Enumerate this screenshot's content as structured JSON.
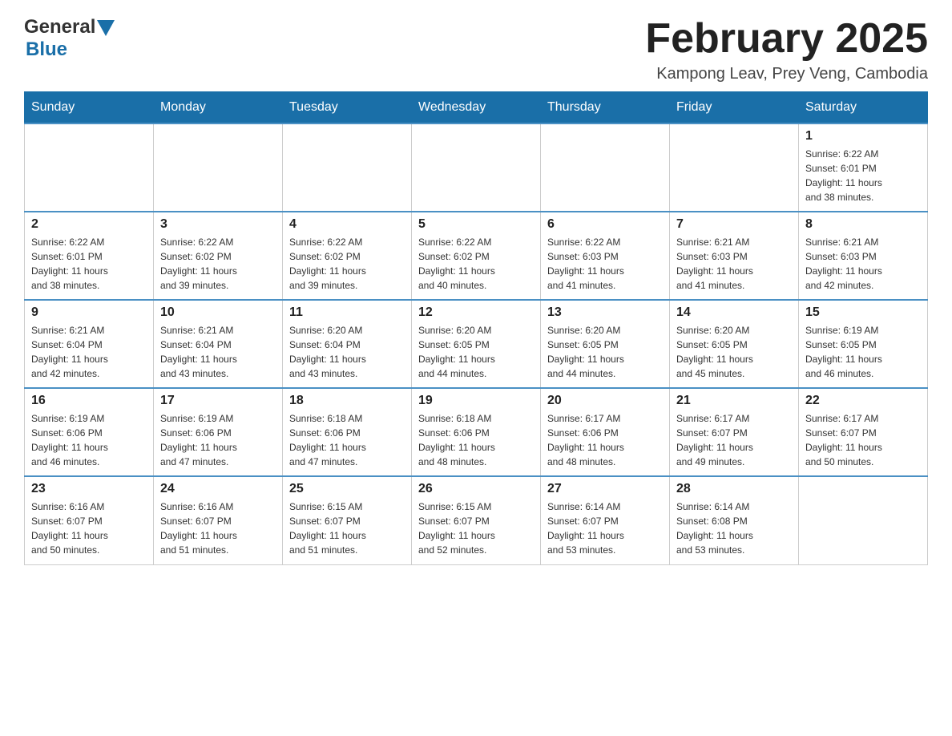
{
  "header": {
    "logo_general": "General",
    "logo_blue": "Blue",
    "month_title": "February 2025",
    "location": "Kampong Leav, Prey Veng, Cambodia"
  },
  "days_of_week": [
    "Sunday",
    "Monday",
    "Tuesday",
    "Wednesday",
    "Thursday",
    "Friday",
    "Saturday"
  ],
  "weeks": [
    [
      {
        "day": "",
        "info": ""
      },
      {
        "day": "",
        "info": ""
      },
      {
        "day": "",
        "info": ""
      },
      {
        "day": "",
        "info": ""
      },
      {
        "day": "",
        "info": ""
      },
      {
        "day": "",
        "info": ""
      },
      {
        "day": "1",
        "info": "Sunrise: 6:22 AM\nSunset: 6:01 PM\nDaylight: 11 hours\nand 38 minutes."
      }
    ],
    [
      {
        "day": "2",
        "info": "Sunrise: 6:22 AM\nSunset: 6:01 PM\nDaylight: 11 hours\nand 38 minutes."
      },
      {
        "day": "3",
        "info": "Sunrise: 6:22 AM\nSunset: 6:02 PM\nDaylight: 11 hours\nand 39 minutes."
      },
      {
        "day": "4",
        "info": "Sunrise: 6:22 AM\nSunset: 6:02 PM\nDaylight: 11 hours\nand 39 minutes."
      },
      {
        "day": "5",
        "info": "Sunrise: 6:22 AM\nSunset: 6:02 PM\nDaylight: 11 hours\nand 40 minutes."
      },
      {
        "day": "6",
        "info": "Sunrise: 6:22 AM\nSunset: 6:03 PM\nDaylight: 11 hours\nand 41 minutes."
      },
      {
        "day": "7",
        "info": "Sunrise: 6:21 AM\nSunset: 6:03 PM\nDaylight: 11 hours\nand 41 minutes."
      },
      {
        "day": "8",
        "info": "Sunrise: 6:21 AM\nSunset: 6:03 PM\nDaylight: 11 hours\nand 42 minutes."
      }
    ],
    [
      {
        "day": "9",
        "info": "Sunrise: 6:21 AM\nSunset: 6:04 PM\nDaylight: 11 hours\nand 42 minutes."
      },
      {
        "day": "10",
        "info": "Sunrise: 6:21 AM\nSunset: 6:04 PM\nDaylight: 11 hours\nand 43 minutes."
      },
      {
        "day": "11",
        "info": "Sunrise: 6:20 AM\nSunset: 6:04 PM\nDaylight: 11 hours\nand 43 minutes."
      },
      {
        "day": "12",
        "info": "Sunrise: 6:20 AM\nSunset: 6:05 PM\nDaylight: 11 hours\nand 44 minutes."
      },
      {
        "day": "13",
        "info": "Sunrise: 6:20 AM\nSunset: 6:05 PM\nDaylight: 11 hours\nand 44 minutes."
      },
      {
        "day": "14",
        "info": "Sunrise: 6:20 AM\nSunset: 6:05 PM\nDaylight: 11 hours\nand 45 minutes."
      },
      {
        "day": "15",
        "info": "Sunrise: 6:19 AM\nSunset: 6:05 PM\nDaylight: 11 hours\nand 46 minutes."
      }
    ],
    [
      {
        "day": "16",
        "info": "Sunrise: 6:19 AM\nSunset: 6:06 PM\nDaylight: 11 hours\nand 46 minutes."
      },
      {
        "day": "17",
        "info": "Sunrise: 6:19 AM\nSunset: 6:06 PM\nDaylight: 11 hours\nand 47 minutes."
      },
      {
        "day": "18",
        "info": "Sunrise: 6:18 AM\nSunset: 6:06 PM\nDaylight: 11 hours\nand 47 minutes."
      },
      {
        "day": "19",
        "info": "Sunrise: 6:18 AM\nSunset: 6:06 PM\nDaylight: 11 hours\nand 48 minutes."
      },
      {
        "day": "20",
        "info": "Sunrise: 6:17 AM\nSunset: 6:06 PM\nDaylight: 11 hours\nand 48 minutes."
      },
      {
        "day": "21",
        "info": "Sunrise: 6:17 AM\nSunset: 6:07 PM\nDaylight: 11 hours\nand 49 minutes."
      },
      {
        "day": "22",
        "info": "Sunrise: 6:17 AM\nSunset: 6:07 PM\nDaylight: 11 hours\nand 50 minutes."
      }
    ],
    [
      {
        "day": "23",
        "info": "Sunrise: 6:16 AM\nSunset: 6:07 PM\nDaylight: 11 hours\nand 50 minutes."
      },
      {
        "day": "24",
        "info": "Sunrise: 6:16 AM\nSunset: 6:07 PM\nDaylight: 11 hours\nand 51 minutes."
      },
      {
        "day": "25",
        "info": "Sunrise: 6:15 AM\nSunset: 6:07 PM\nDaylight: 11 hours\nand 51 minutes."
      },
      {
        "day": "26",
        "info": "Sunrise: 6:15 AM\nSunset: 6:07 PM\nDaylight: 11 hours\nand 52 minutes."
      },
      {
        "day": "27",
        "info": "Sunrise: 6:14 AM\nSunset: 6:07 PM\nDaylight: 11 hours\nand 53 minutes."
      },
      {
        "day": "28",
        "info": "Sunrise: 6:14 AM\nSunset: 6:08 PM\nDaylight: 11 hours\nand 53 minutes."
      },
      {
        "day": "",
        "info": ""
      }
    ]
  ]
}
